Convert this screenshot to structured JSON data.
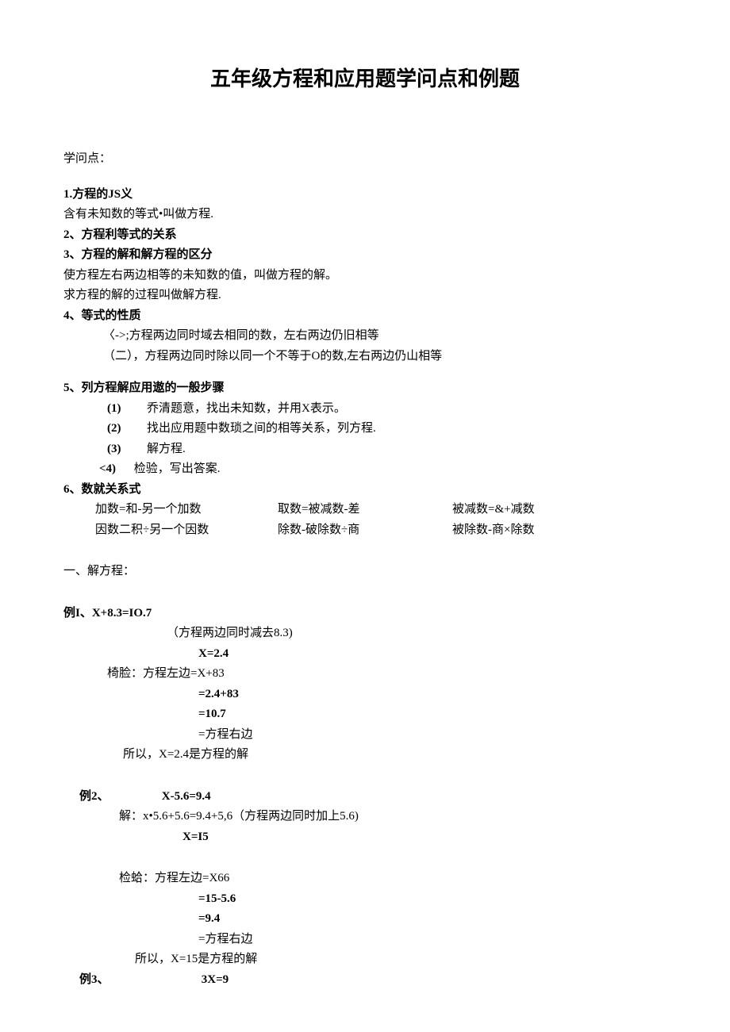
{
  "title": "五年级方程和应用题学问点和例题",
  "knowledge_label": "学问点：",
  "points": {
    "p1_head": "1.方程的JS义",
    "p1_body": "含有未知数的等式•叫做方程.",
    "p2_head": "2、方程利等式的关系",
    "p3_head": "3、方程的解和解方程的区分",
    "p3_body1": "使方程左右两边相等的未知数的值，叫做方程的解。",
    "p3_body2": "求方程的解的过程叫做解方程.",
    "p4_head": "4、等式的性质",
    "p4_body1": "〈->;方程两边同时域去相同的数，左右两边仍旧相等",
    "p4_body2": "（二），方程两边同时除以同一个不等于O的数,左右两边仍山相等",
    "p5_head": "5、列方程解应用遨的一般步骤",
    "p5_s1_num": "(1)",
    "p5_s1": "乔清题意，找出未知数，并用X表示。",
    "p5_s2_num": "(2)",
    "p5_s2": "找出应用题中数琐之间的相等关系，列方程.",
    "p5_s3_num": "(3)",
    "p5_s3": "解方程.",
    "p5_s4_num": "<4)",
    "p5_s4": "检验，写出答案.",
    "p6_head": "6、数就关系式",
    "rel_r1_c1": "加数=和-另一个加数",
    "rel_r1_c2": "取数=被减数-差",
    "rel_r1_c3": "被减数=&+减数",
    "rel_r2_c1": "因数二积÷另一个因数",
    "rel_r2_c2": "除数-破除数÷商",
    "rel_r2_c3": "被除数-商×除数"
  },
  "section1_head": "一、解方程：",
  "ex1": {
    "label": "例I、X+8.3=IO.7",
    "l1": "（方程两边同时减去8.3)",
    "l2": "X=2.4",
    "chk_head": "椅脸：方程左边=X+83",
    "l3": "=2.4+83",
    "l4": "=10.7",
    "l5": "=方程右边",
    "concl": "所以，X=2.4是方程的解"
  },
  "ex2": {
    "label_pre": "例2、",
    "label_eq": "X-5.6=9.4",
    "l1": "解：x•5.6+5.6=9.4+5,6（方程两边同时加上5.6)",
    "l2": "X=I5",
    "chk_head": "检蛤：方程左边=X66",
    "l3": "=15-5.6",
    "l4": "=9.4",
    "l5": "=方程右边",
    "concl": "所以，X=15是方程的解"
  },
  "ex3": {
    "label_pre": "例3、",
    "label_eq": "3X=9"
  }
}
